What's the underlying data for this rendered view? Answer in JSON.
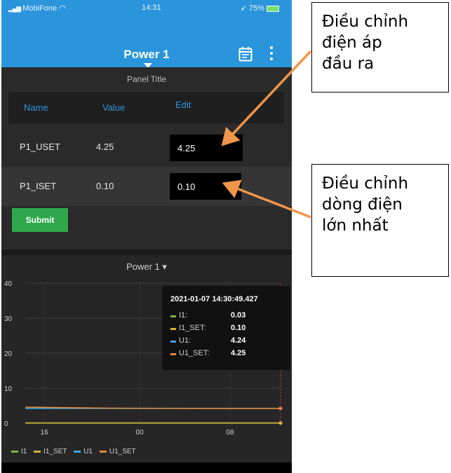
{
  "status_bar": {
    "carrier": "MobiFone",
    "time": "14:31",
    "battery": "75%"
  },
  "header": {
    "title": "Power 1"
  },
  "panel": {
    "title": "Panel Title",
    "columns": [
      "Name",
      "Value",
      "Edit"
    ],
    "rows": [
      {
        "name": "P1_USET",
        "value": "4.25",
        "edit": "4.25"
      },
      {
        "name": "P1_ISET",
        "value": "0.10",
        "edit": "0.10"
      }
    ],
    "submit_label": "Submit"
  },
  "chart_data": {
    "type": "line",
    "title": "Power 1",
    "x_ticks": [
      "16",
      "00",
      "08"
    ],
    "y_ticks": [
      "40",
      "30",
      "20",
      "10",
      "0"
    ],
    "ylim": [
      0,
      40
    ],
    "grid": true,
    "series": [
      {
        "name": "I1",
        "color": "#7fb34a",
        "values": [
          0.03,
          0.03,
          0.03,
          0.03
        ]
      },
      {
        "name": "I1_SET",
        "color": "#d8b23a",
        "values": [
          0.1,
          0.1,
          0.1,
          0.1
        ]
      },
      {
        "name": "U1",
        "color": "#3aa8e0",
        "values": [
          4.24,
          4.24,
          4.24,
          4.24
        ]
      },
      {
        "name": "U1_SET",
        "color": "#e58a3a",
        "values": [
          4.6,
          4.3,
          4.25,
          4.25
        ]
      }
    ],
    "legend": [
      "I1",
      "I1_SET",
      "U1",
      "U1_SET"
    ],
    "legend_position": "bottom-left",
    "tooltip": {
      "timestamp": "2021-01-07 14:30:49.427",
      "items": [
        {
          "label": "I1:",
          "value": "0.03",
          "color": "#7fb34a"
        },
        {
          "label": "I1_SET:",
          "value": "0.10",
          "color": "#d8b23a"
        },
        {
          "label": "U1:",
          "value": "4.24",
          "color": "#3aa8e0"
        },
        {
          "label": "U1_SET:",
          "value": "4.25",
          "color": "#e58a3a"
        }
      ]
    }
  },
  "callouts": {
    "voltage": [
      "Điều chỉnh",
      "điện áp",
      "đầu ra"
    ],
    "current": [
      "Điều chỉnh",
      "dòng điện",
      "lớn nhất"
    ]
  },
  "colors": {
    "header": "#2b95dc",
    "accent_blue": "#2b95dc",
    "submit": "#2ea84a",
    "arrow": "#f0954a"
  }
}
